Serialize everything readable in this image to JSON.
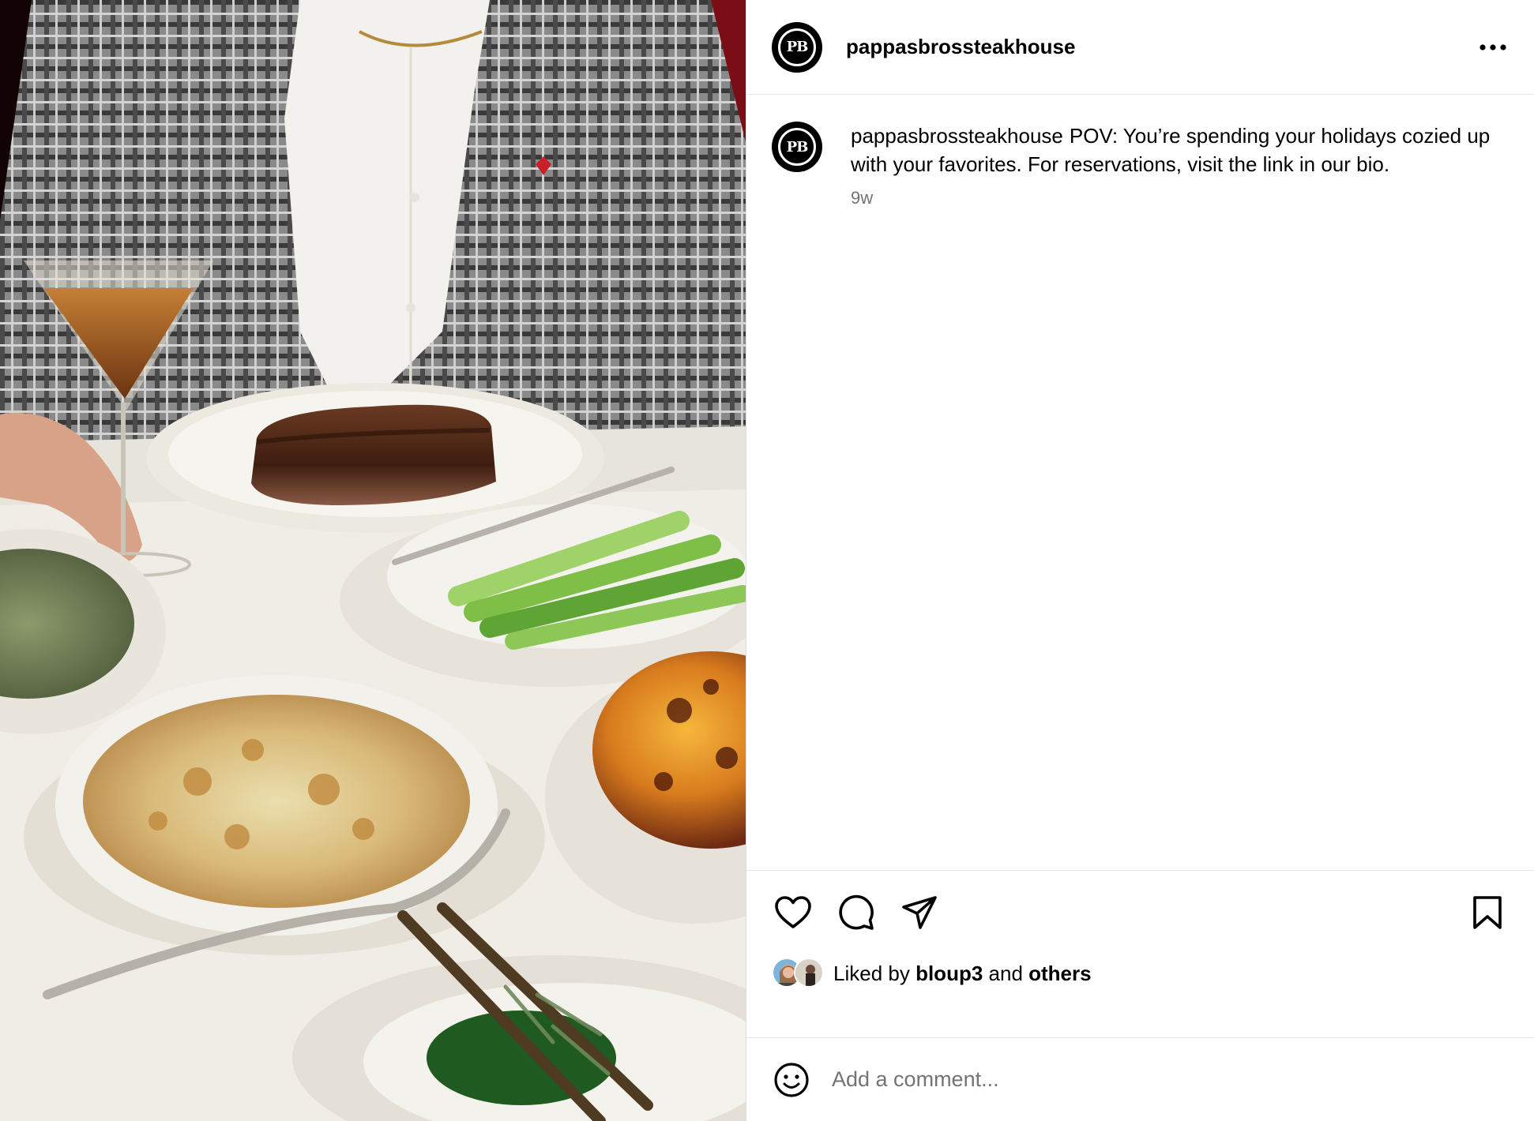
{
  "post": {
    "username": "pappasbrossteakhouse",
    "avatar_initials": "PB",
    "photo_alt": "Steak, asparagus, creamed spinach and gratins on a white tablecloth"
  },
  "header": {
    "username": "pappasbrossteakhouse",
    "more_icon": "more-horizontal-icon"
  },
  "caption": {
    "username": "pappasbrossteakhouse",
    "text": "POV: You’re spending your holidays cozied up with your favorites. For reservations, visit the link in our bio.",
    "time": "9w"
  },
  "actions": {
    "like_icon": "heart-icon",
    "comment_icon": "comment-icon",
    "share_icon": "share-icon",
    "save_icon": "bookmark-icon"
  },
  "likes": {
    "prefix": "Liked by ",
    "user": "bloup3",
    "middle": " and ",
    "others": "others"
  },
  "comment_box": {
    "placeholder": "Add a comment...",
    "emoji_icon": "emoji-icon"
  },
  "colors": {
    "text": "#000000",
    "muted": "#737373",
    "divider": "#e6e6e6",
    "tablecloth": "#f0ede6",
    "blazer": "#6b6b6b",
    "booth_red": "#5a0a10"
  }
}
